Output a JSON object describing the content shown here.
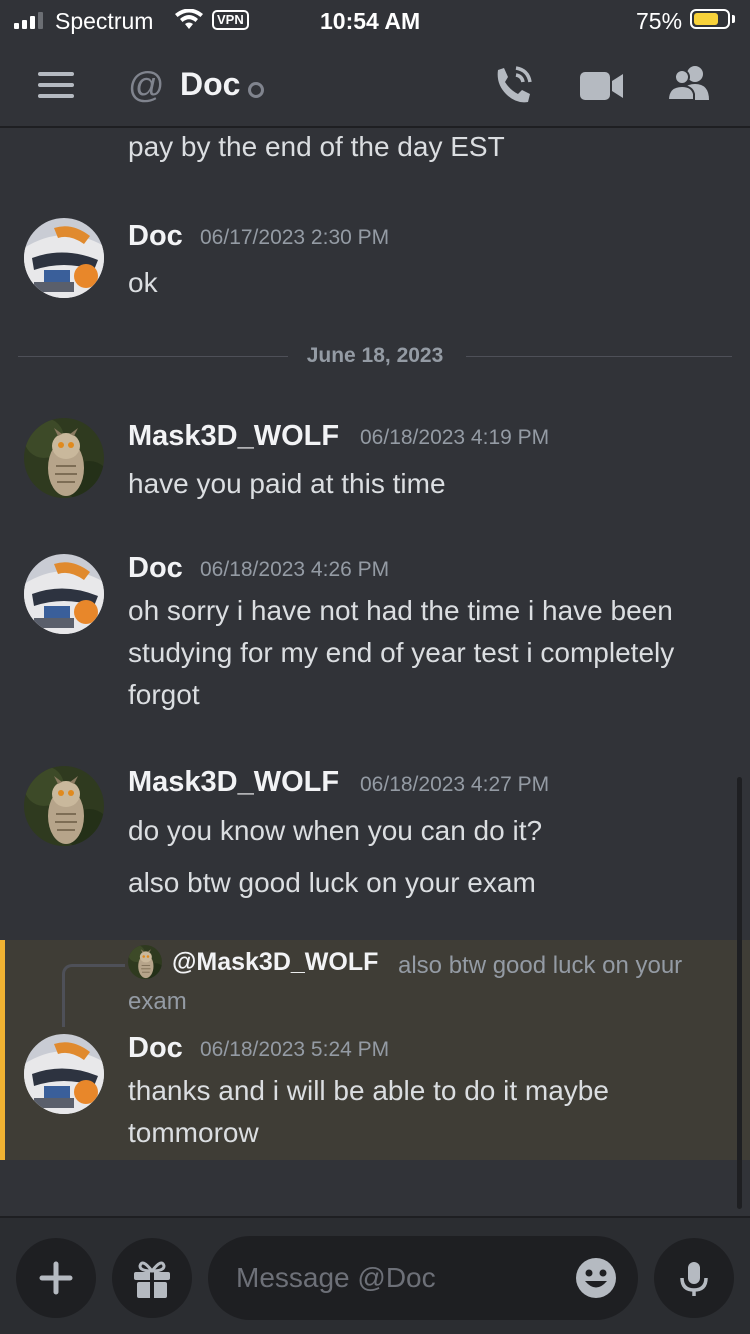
{
  "status_bar": {
    "carrier": "Spectrum",
    "vpn": "VPN",
    "time": "10:54 AM",
    "battery_percent": "75%",
    "battery_level": 0.75
  },
  "header": {
    "channel_name": "Doc"
  },
  "messages": {
    "partial": "pay by the end of the day EST",
    "date_divider": "June 18, 2023",
    "m1": {
      "author": "Doc",
      "timestamp": "06/17/2023 2:30 PM",
      "text": "ok"
    },
    "m2": {
      "author": "Mask3D_WOLF",
      "timestamp": "06/18/2023 4:19 PM",
      "text": "have you paid at this time"
    },
    "m3": {
      "author": "Doc",
      "timestamp": "06/18/2023 4:26 PM",
      "text": "oh sorry i have not had the time i have been studying for my end of year test i completely forgot"
    },
    "m4": {
      "author": "Mask3D_WOLF",
      "timestamp": "06/18/2023 4:27 PM",
      "text": "do you know when you can do it?",
      "text2": "also btw good luck on your exam"
    },
    "m5": {
      "reply_author": "@Mask3D_WOLF",
      "reply_text": "also btw good luck on your exam",
      "author": "Doc",
      "timestamp": "06/18/2023 5:24 PM",
      "text": "thanks and i will be able to do it maybe tommorow"
    }
  },
  "composer": {
    "placeholder": "Message @Doc"
  },
  "colors": {
    "background": "#313338",
    "mention_highlight": "#3f3d36",
    "mention_bar": "#f0b232",
    "input_bg": "#1e1f22"
  }
}
